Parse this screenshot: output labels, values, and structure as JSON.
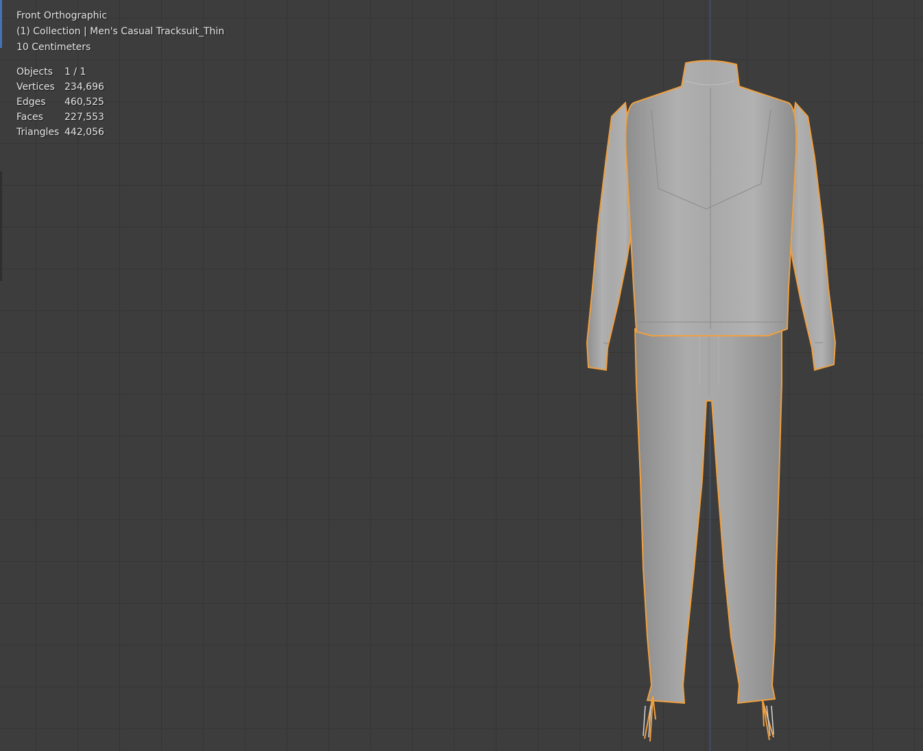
{
  "viewport": {
    "view_name": "Front Orthographic",
    "collection": "(1) Collection | Men's Casual Tracksuit_Thin",
    "grid_scale": "10 Centimeters"
  },
  "stats": [
    {
      "label": "Objects",
      "value": "1 / 1"
    },
    {
      "label": "Vertices",
      "value": "234,696"
    },
    {
      "label": "Edges",
      "value": "460,525"
    },
    {
      "label": "Faces",
      "value": "227,553"
    },
    {
      "label": "Triangles",
      "value": "442,056"
    }
  ],
  "colors": {
    "background": "#3d3d3d",
    "grid": "#353535",
    "selection_outline": "#f0a040",
    "mesh": "#a8a8a8",
    "z_axis": "#3f5f8a"
  }
}
